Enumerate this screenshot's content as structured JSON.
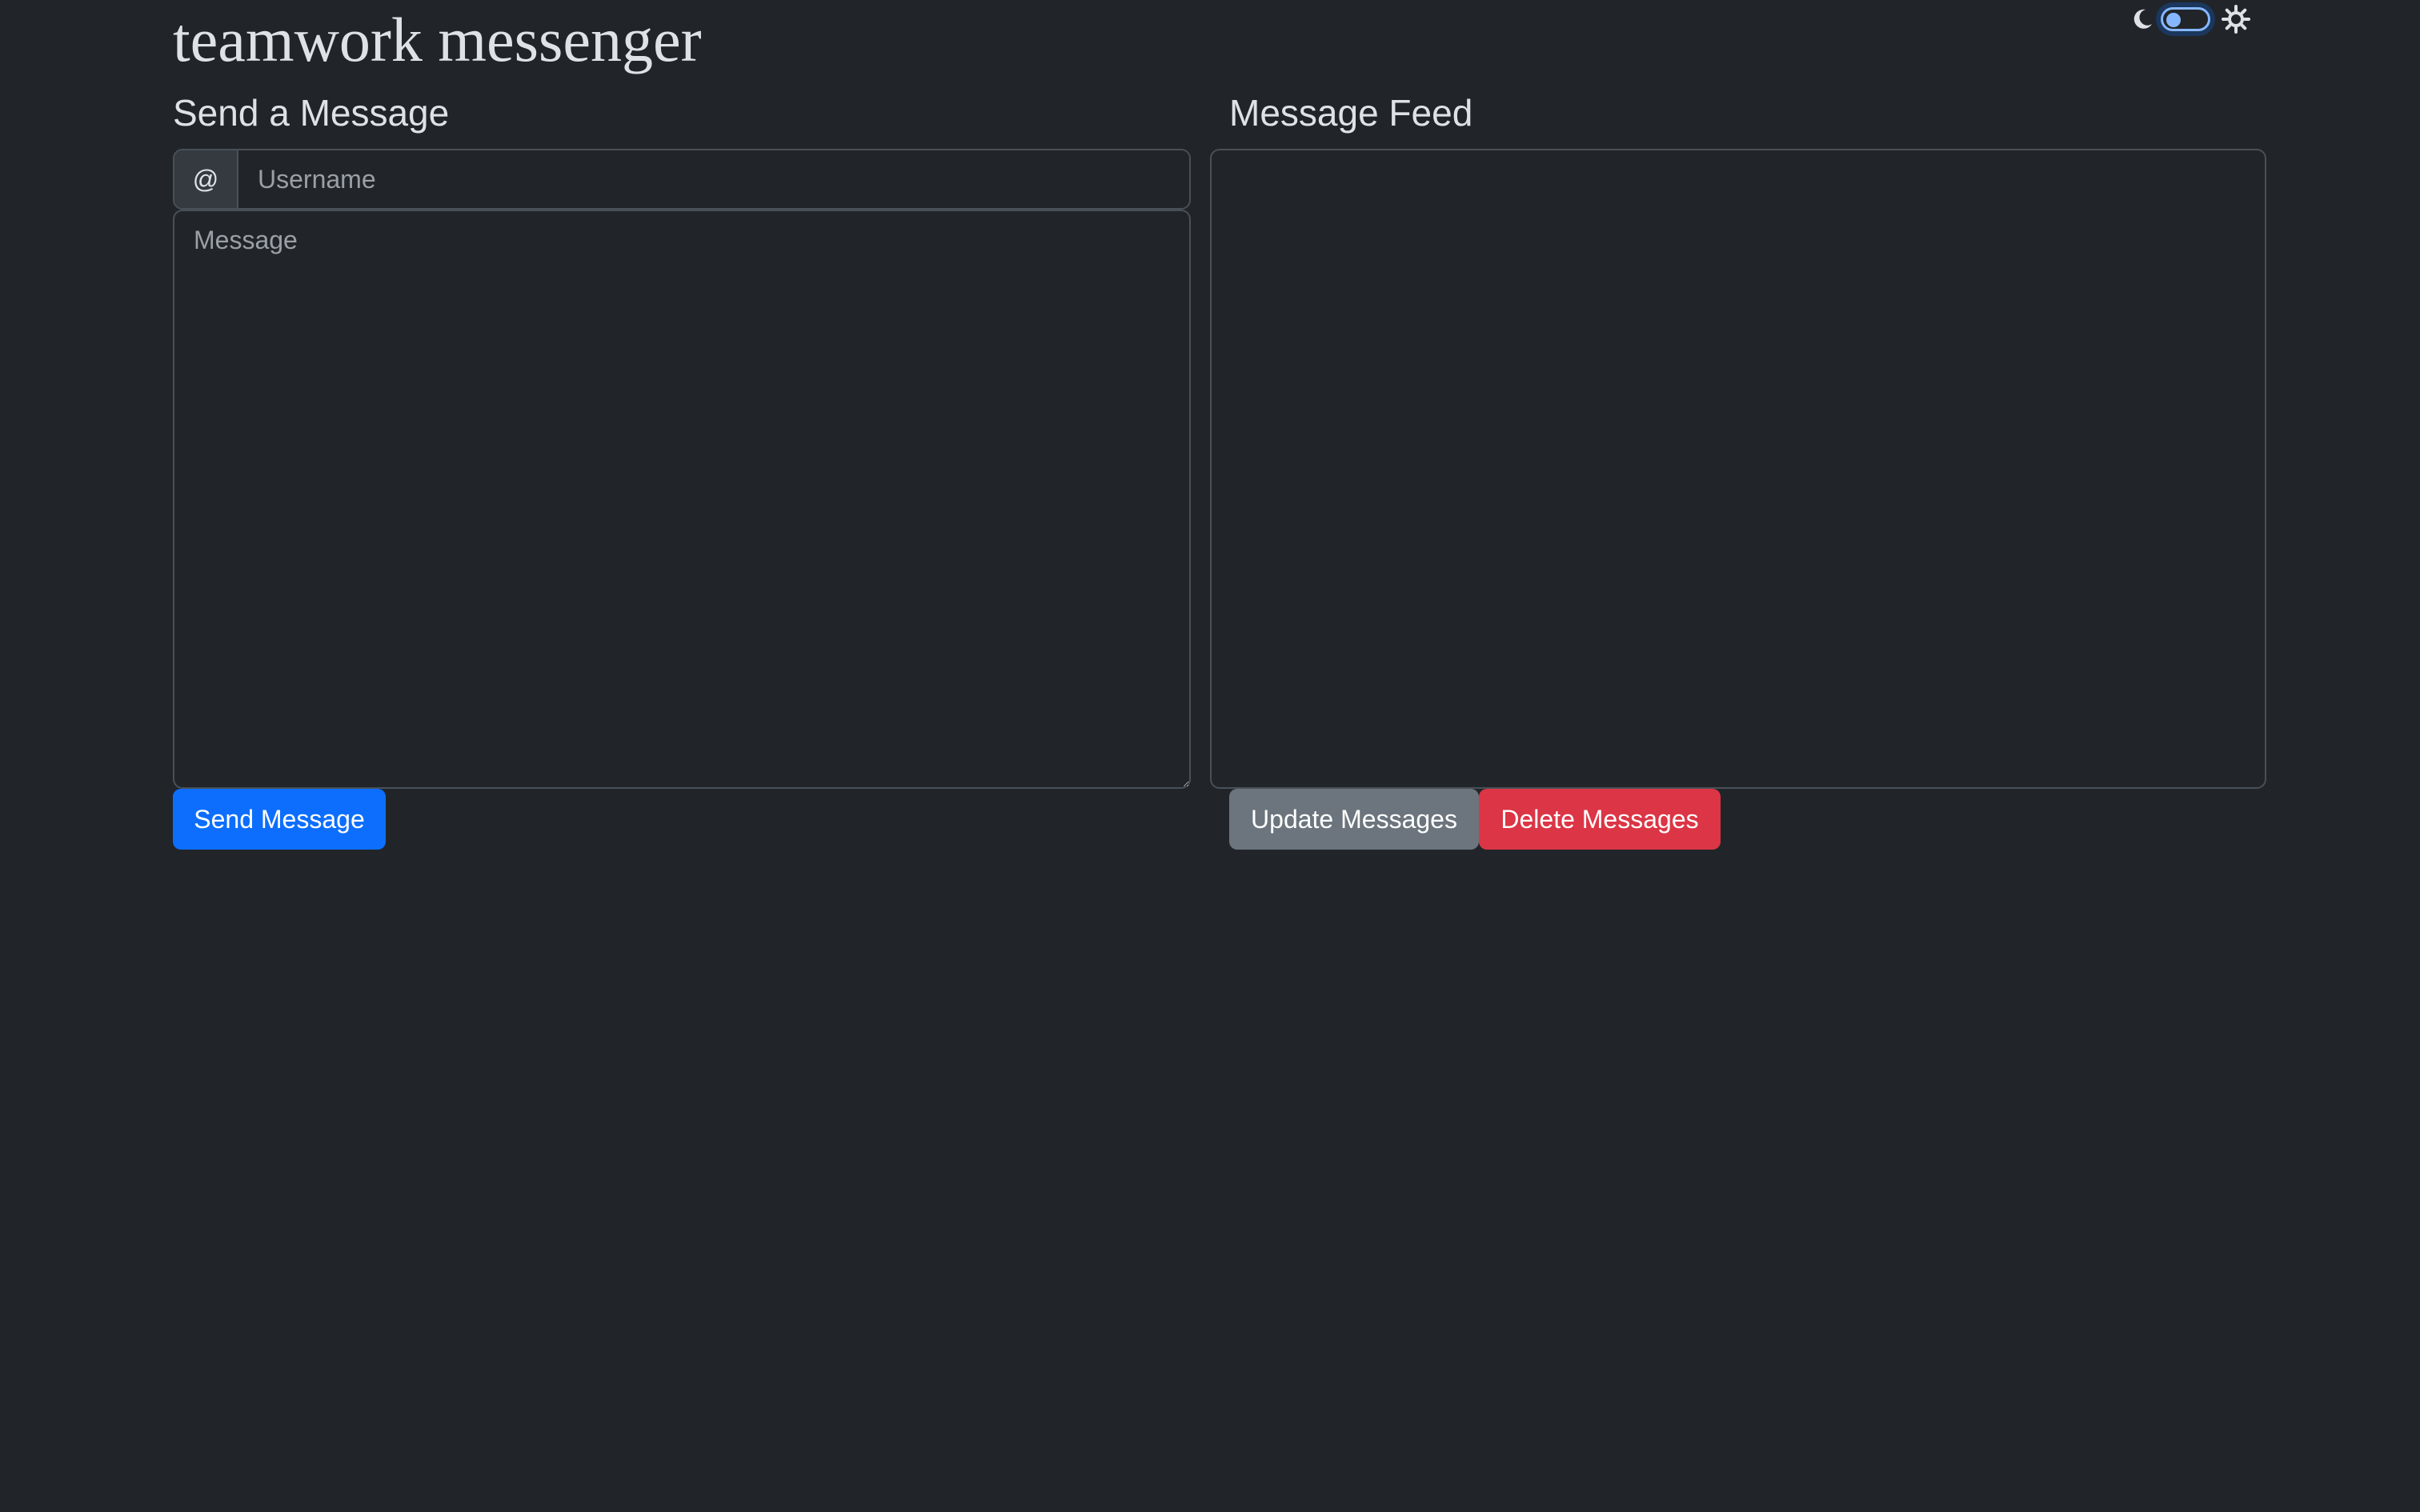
{
  "app": {
    "title": "teamwork messenger"
  },
  "theme_toggle": {
    "dark_icon": "moon-icon",
    "light_icon": "sun-icon",
    "state": "dark"
  },
  "send_panel": {
    "heading": "Send a Message",
    "username_prefix": "@",
    "username_placeholder": "Username",
    "username_value": "",
    "message_placeholder": "Message",
    "message_value": "",
    "send_button_label": "Send Message"
  },
  "feed_panel": {
    "heading": "Message Feed",
    "messages": [],
    "update_button_label": "Update Messages",
    "delete_button_label": "Delete Messages"
  },
  "colors": {
    "background": "#212529",
    "primary": "#0d6efd",
    "secondary": "#6c757d",
    "danger": "#dc3545",
    "switch_accent": "#86b7fe"
  }
}
